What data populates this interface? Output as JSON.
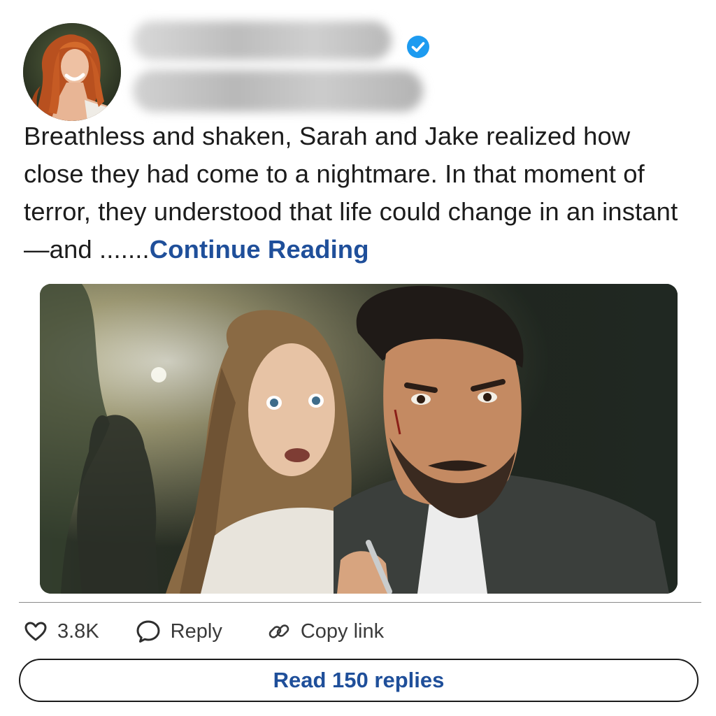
{
  "post": {
    "text_main": "Breathless and shaken, Sarah and Jake realized how close they had come to a nightmare. In that moment of terror, they understood that life could change in an instant—and .......",
    "continue_label": "Continue Reading"
  },
  "actions": {
    "likes": "3.8K",
    "reply": "Reply",
    "copy_link": "Copy link"
  },
  "read_replies_label": "Read 150 replies",
  "icons": {
    "verified": "verified-badge-icon",
    "like": "heart-icon",
    "reply": "speech-bubble-icon",
    "copy": "link-icon"
  },
  "colors": {
    "link": "#1f4f9a",
    "verified": "#1d9bf0"
  }
}
